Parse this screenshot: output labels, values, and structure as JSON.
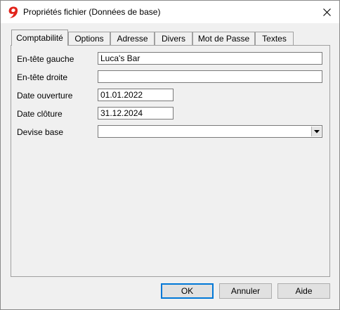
{
  "window": {
    "title": "Propriétés fichier (Données de base)",
    "close_icon": "close-icon",
    "app_icon": "banana-logo-icon",
    "accent_color": "#e2231a"
  },
  "tabs": [
    {
      "label": "Comptabilité",
      "active": true
    },
    {
      "label": "Options"
    },
    {
      "label": "Adresse"
    },
    {
      "label": "Divers"
    },
    {
      "label": "Mot de Passe"
    },
    {
      "label": "Textes"
    }
  ],
  "form": {
    "header_left": {
      "label": "En-tête gauche",
      "value": "Luca's Bar"
    },
    "header_right": {
      "label": "En-tête droite",
      "value": ""
    },
    "opening_date": {
      "label": "Date ouverture",
      "value": "01.01.2022"
    },
    "closing_date": {
      "label": "Date clôture",
      "value": "31.12.2024"
    },
    "base_currency": {
      "label": "Devise base",
      "value": ""
    }
  },
  "buttons": {
    "ok": "OK",
    "cancel": "Annuler",
    "help": "Aide"
  }
}
